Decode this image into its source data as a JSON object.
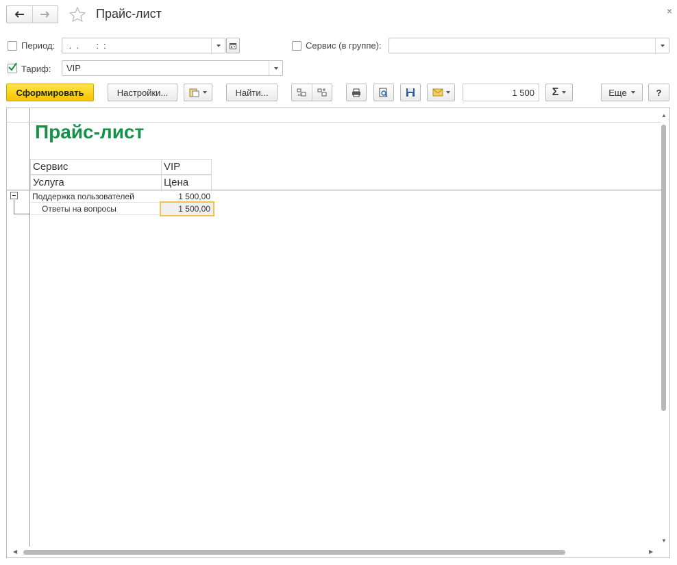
{
  "window": {
    "title": "Прайс-лист",
    "close": "×"
  },
  "filters": {
    "period_label": "Период:",
    "period_value": " .  .       :  :",
    "period_checked": false,
    "service_label": "Сервис (в группе):",
    "service_value": "",
    "service_checked": false,
    "tariff_label": "Тариф:",
    "tariff_value": "VIP",
    "tariff_checked": true
  },
  "toolbar": {
    "generate_label": "Сформировать",
    "settings_label": "Настройки...",
    "find_label": "Найти...",
    "sum_value": "1 500",
    "sum_symbol": "Σ",
    "more_label": "Еще",
    "help_label": "?"
  },
  "report": {
    "title": "Прайс-лист",
    "header": {
      "service_label": "Сервис",
      "service_value": "VIP",
      "col_service": "Услуга",
      "col_price": "Цена"
    },
    "rows": [
      {
        "name": "Поддержка пользователей",
        "price": "1 500,00"
      },
      {
        "name": "Ответы на вопросы",
        "price": "1 500,00"
      }
    ]
  },
  "colors": {
    "accent": "#f6c300",
    "report_title": "#14924a",
    "selection": "#f3c14c"
  }
}
